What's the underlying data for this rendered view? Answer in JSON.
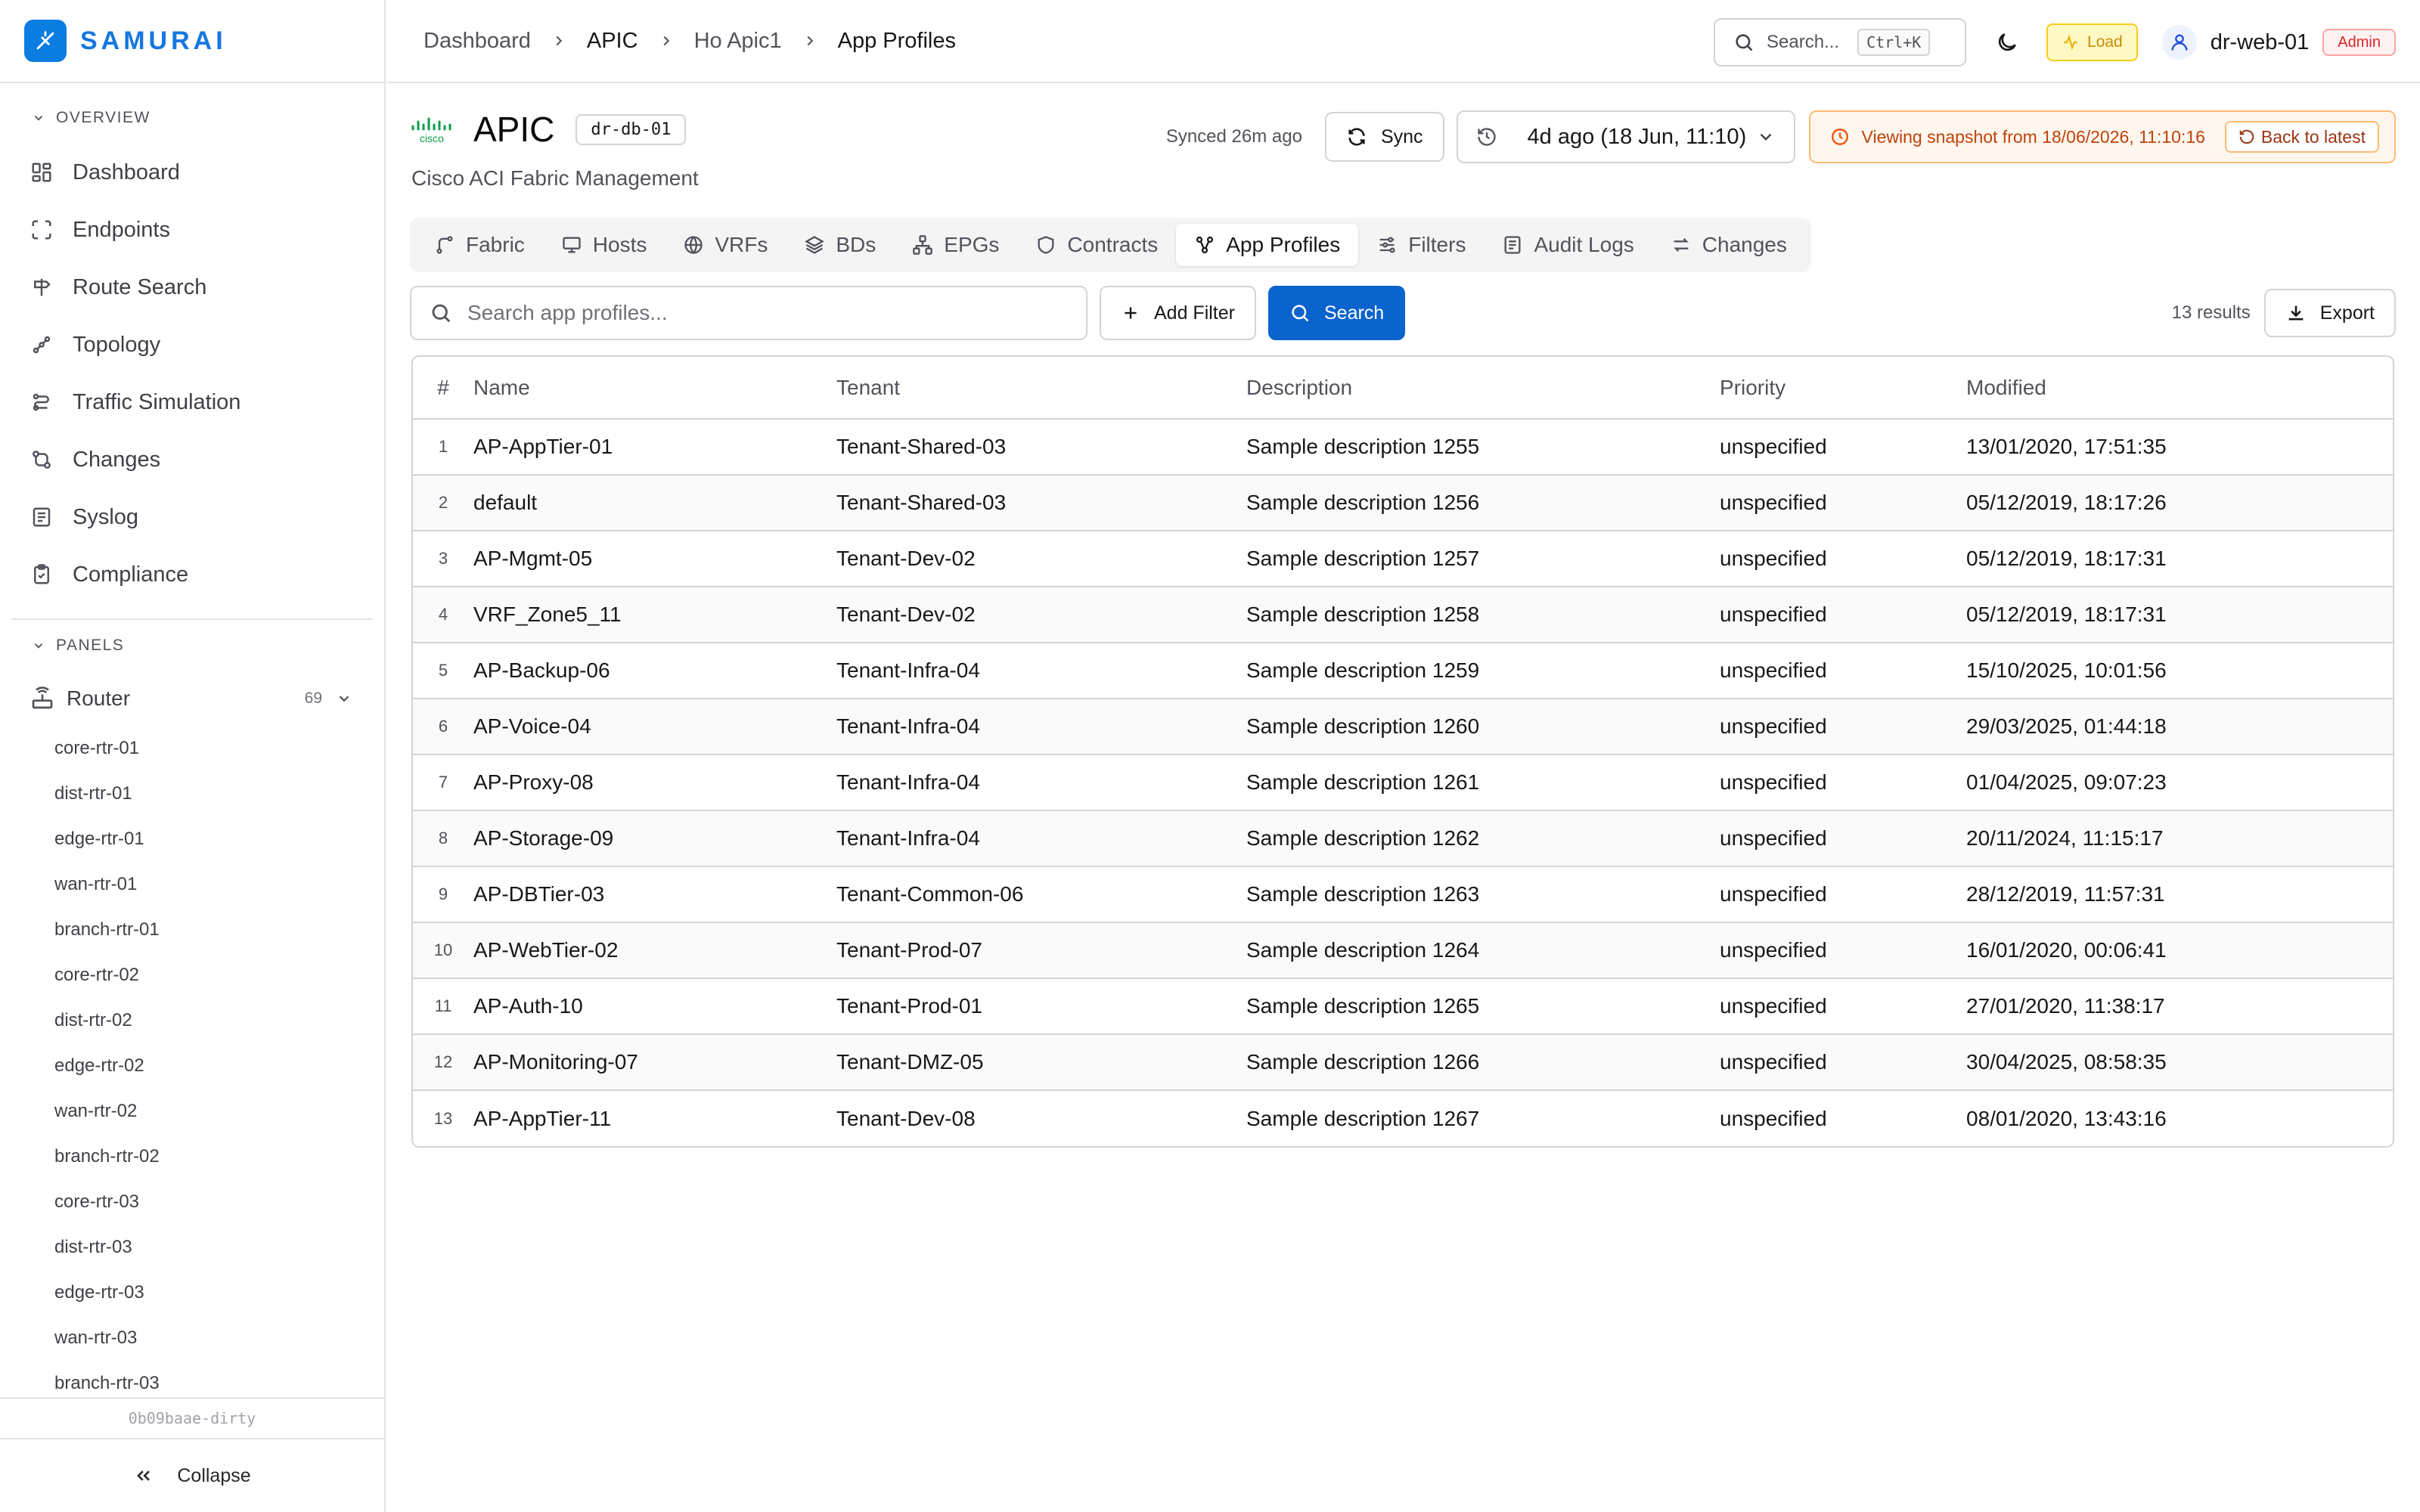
{
  "brand": {
    "name": "SAMURAI",
    "color": "#1677e0"
  },
  "sidebar": {
    "overview_label": "OVERVIEW",
    "items": [
      {
        "label": "Dashboard",
        "icon": "dashboard-icon"
      },
      {
        "label": "Endpoints",
        "icon": "endpoints-icon"
      },
      {
        "label": "Route Search",
        "icon": "route-search-icon"
      },
      {
        "label": "Topology",
        "icon": "topology-icon"
      },
      {
        "label": "Traffic Simulation",
        "icon": "traffic-icon"
      },
      {
        "label": "Changes",
        "icon": "changes-icon"
      },
      {
        "label": "Syslog",
        "icon": "syslog-icon"
      },
      {
        "label": "Compliance",
        "icon": "compliance-icon"
      }
    ],
    "panels_label": "PANELS",
    "router": {
      "label": "Router",
      "count": "69"
    },
    "routers": [
      "core-rtr-01",
      "dist-rtr-01",
      "edge-rtr-01",
      "wan-rtr-01",
      "branch-rtr-01",
      "core-rtr-02",
      "dist-rtr-02",
      "edge-rtr-02",
      "wan-rtr-02",
      "branch-rtr-02",
      "core-rtr-03",
      "dist-rtr-03",
      "edge-rtr-03",
      "wan-rtr-03",
      "branch-rtr-03"
    ],
    "version": "0b09baae-dirty",
    "collapse_label": "Collapse"
  },
  "header": {
    "breadcrumb": [
      "Dashboard",
      "APIC",
      "Ho Apic1",
      "App Profiles"
    ],
    "search_placeholder": "Search...",
    "shortcut": "Ctrl+K",
    "load_label": "Load",
    "username": "dr-web-01",
    "role": "Admin"
  },
  "device": {
    "logo_text": "cisco",
    "title": "APIC",
    "chip": "dr-db-01",
    "subtitle": "Cisco ACI Fabric Management",
    "synced": "Synced 26m ago",
    "sync_label": "Sync",
    "snapshot": "4d ago (18 Jun, 11:10)",
    "banner": "Viewing snapshot from 18/06/2026, 11:10:16",
    "back_label": "Back to latest"
  },
  "tabs": [
    {
      "label": "Fabric",
      "icon": "fabric-icon"
    },
    {
      "label": "Hosts",
      "icon": "monitor-icon"
    },
    {
      "label": "VRFs",
      "icon": "globe-icon"
    },
    {
      "label": "BDs",
      "icon": "layers-icon"
    },
    {
      "label": "EPGs",
      "icon": "network-icon"
    },
    {
      "label": "Contracts",
      "icon": "shield-icon"
    },
    {
      "label": "App Profiles",
      "icon": "share-icon",
      "active": true
    },
    {
      "label": "Filters",
      "icon": "sliders-icon"
    },
    {
      "label": "Audit Logs",
      "icon": "logs-icon"
    },
    {
      "label": "Changes",
      "icon": "arrows-icon"
    }
  ],
  "filter": {
    "placeholder": "Search app profiles...",
    "add_filter_label": "Add Filter",
    "search_label": "Search",
    "results": "13 results",
    "export_label": "Export"
  },
  "table": {
    "columns": [
      "#",
      "Name",
      "Tenant",
      "Description",
      "Priority",
      "Modified"
    ],
    "rows": [
      [
        "1",
        "AP-AppTier-01",
        "Tenant-Shared-03",
        "Sample description 1255",
        "unspecified",
        "13/01/2020, 17:51:35"
      ],
      [
        "2",
        "default",
        "Tenant-Shared-03",
        "Sample description 1256",
        "unspecified",
        "05/12/2019, 18:17:26"
      ],
      [
        "3",
        "AP-Mgmt-05",
        "Tenant-Dev-02",
        "Sample description 1257",
        "unspecified",
        "05/12/2019, 18:17:31"
      ],
      [
        "4",
        "VRF_Zone5_11",
        "Tenant-Dev-02",
        "Sample description 1258",
        "unspecified",
        "05/12/2019, 18:17:31"
      ],
      [
        "5",
        "AP-Backup-06",
        "Tenant-Infra-04",
        "Sample description 1259",
        "unspecified",
        "15/10/2025, 10:01:56"
      ],
      [
        "6",
        "AP-Voice-04",
        "Tenant-Infra-04",
        "Sample description 1260",
        "unspecified",
        "29/03/2025, 01:44:18"
      ],
      [
        "7",
        "AP-Proxy-08",
        "Tenant-Infra-04",
        "Sample description 1261",
        "unspecified",
        "01/04/2025, 09:07:23"
      ],
      [
        "8",
        "AP-Storage-09",
        "Tenant-Infra-04",
        "Sample description 1262",
        "unspecified",
        "20/11/2024, 11:15:17"
      ],
      [
        "9",
        "AP-DBTier-03",
        "Tenant-Common-06",
        "Sample description 1263",
        "unspecified",
        "28/12/2019, 11:57:31"
      ],
      [
        "10",
        "AP-WebTier-02",
        "Tenant-Prod-07",
        "Sample description 1264",
        "unspecified",
        "16/01/2020, 00:06:41"
      ],
      [
        "11",
        "AP-Auth-10",
        "Tenant-Prod-01",
        "Sample description 1265",
        "unspecified",
        "27/01/2020, 11:38:17"
      ],
      [
        "12",
        "AP-Monitoring-07",
        "Tenant-DMZ-05",
        "Sample description 1266",
        "unspecified",
        "30/04/2025, 08:58:35"
      ],
      [
        "13",
        "AP-AppTier-11",
        "Tenant-Dev-08",
        "Sample description 1267",
        "unspecified",
        "08/01/2020, 13:43:16"
      ]
    ]
  }
}
